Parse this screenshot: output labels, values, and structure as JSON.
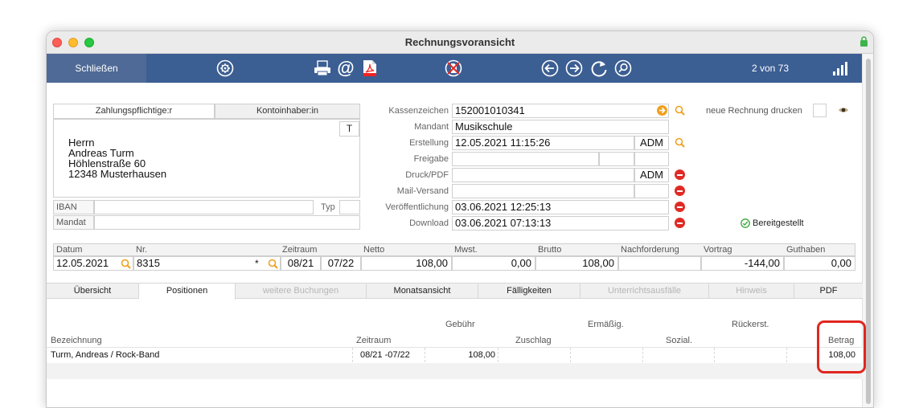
{
  "window": {
    "title": "Rechnungsvoransicht"
  },
  "toolbar": {
    "close_label": "Schließen",
    "page_counter": "2 von 73"
  },
  "address": {
    "tabs": [
      "Zahlungspflichtige:r",
      "Kontoinhaber:in"
    ],
    "t_button": "T",
    "lines": [
      "Herrn",
      "Andreas Turm",
      "Höhlenstraße 60",
      "12348 Musterhausen"
    ],
    "iban_label": "IBAN",
    "typ_label": "Typ",
    "mandat_label": "Mandat"
  },
  "info": {
    "kassenzeichen_label": "Kassenzeichen",
    "kassenzeichen": "152001010341",
    "mandant_label": "Mandant",
    "mandant": "Musikschule",
    "erstellung_label": "Erstellung",
    "erstellung": "12.05.2021 11:15:26",
    "erstellung_user": "ADM",
    "freigabe_label": "Freigabe",
    "druck_label": "Druck/PDF",
    "druck_user": "ADM",
    "mail_label": "Mail-Versand",
    "veroeff_label": "Veröffentlichung",
    "veroeff": "03.06.2021 12:25:13",
    "download_label": "Download",
    "download": "03.06.2021 07:13:13"
  },
  "right": {
    "neue_label": "neue Rechnung drucken",
    "status": "Bereitgestellt"
  },
  "invoice": {
    "headers": [
      "Datum",
      "Nr.",
      "Zeitraum",
      "Netto",
      "Mwst.",
      "Brutto",
      "Nachforderung",
      "Vortrag",
      "Guthaben"
    ],
    "datum": "12.05.2021",
    "nr": "8315",
    "star": "*",
    "zeit_von": "08/21",
    "zeit_bis": "07/22",
    "netto": "108,00",
    "mwst": "0,00",
    "brutto": "108,00",
    "vortrag": "-144,00",
    "guthaben": "0,00"
  },
  "tabs": [
    "Übersicht",
    "Positionen",
    "weitere Buchungen",
    "Monatsansicht",
    "Fälligkeiten",
    "Unterrichtsausfälle",
    "Hinweis",
    "PDF"
  ],
  "positions": {
    "h_gebuehr": "Gebühr",
    "h_ermaessig": "Ermäßig.",
    "h_rueckerst": "Rückerst.",
    "h_bezeichnung": "Bezeichnung",
    "h_zeitraum": "Zeitraum",
    "h_zuschlag": "Zuschlag",
    "h_sozial": "Sozial.",
    "h_betrag": "Betrag",
    "row": {
      "bezeichnung": "Turm, Andreas / Rock-Band",
      "zeitraum": "08/21 -07/22",
      "gebuehr": "108,00",
      "betrag": "108,00"
    }
  },
  "colors": {
    "toolbar": "#3b5e93",
    "highlight": "#e0261f",
    "accent": "#f0a020"
  }
}
